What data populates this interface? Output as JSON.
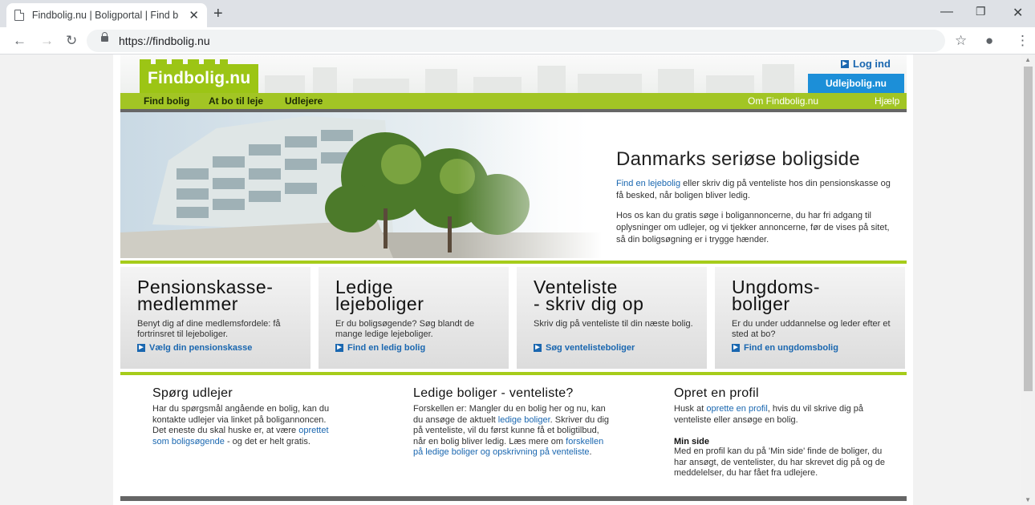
{
  "browser": {
    "tab_title": "Findbolig.nu | Boligportal | Find b",
    "url": "https://findbolig.nu"
  },
  "header": {
    "logo": "Findbolig.nu",
    "login": "Log ind",
    "udlejbolig": "Udlejbolig.nu"
  },
  "nav": {
    "left": [
      "Find bolig",
      "At bo til leje",
      "Udlejere"
    ],
    "right": [
      "Om Findbolig.nu",
      "Hjælp"
    ]
  },
  "hero": {
    "title": "Danmarks seriøse boligside",
    "p1_link": "Find en lejebolig",
    "p1_text": " eller skriv dig på venteliste hos din pensionskasse og få besked, når boligen bliver ledig.",
    "p2": "Hos os kan du gratis søge i boligannoncerne, du har fri adgang til oplysninger om udlejer, og vi tjekker annoncerne, før de vises på sitet, så din boligsøgning er i trygge hænder."
  },
  "tiles": [
    {
      "title_1": "Pensionskasse-",
      "title_2": "medlemmer",
      "text": "Benyt dig af dine medlemsfordele: få fortrinsret til lejeboliger.",
      "link": "Vælg din pensionskasse"
    },
    {
      "title_1": "Ledige",
      "title_2": "lejeboliger",
      "text": "Er du boligsøgende? Søg blandt de mange ledige lejeboliger.",
      "link": "Find en ledig bolig"
    },
    {
      "title_1": "Venteliste",
      "title_2": "- skriv dig op",
      "text": "Skriv dig på venteliste til din næste bolig.",
      "link": "Søg ventelisteboliger"
    },
    {
      "title_1": "Ungdoms-",
      "title_2": "boliger",
      "text": "Er du under uddannelse og leder efter et sted at bo?",
      "link": "Find en ungdomsbolig"
    }
  ],
  "columns": {
    "c1": {
      "title": "Spørg udlejer",
      "p1": "Har du spørgsmål angående en bolig, kan du kontakte udlejer via linket på boligannoncen.",
      "p2_a": "Det eneste du skal huske er, at være ",
      "p2_link": "oprettet som boligsøgende",
      "p2_b": " - og det er helt gratis."
    },
    "c2": {
      "title": "Ledige boliger - venteliste?",
      "p_a": "Forskellen er: Mangler du en bolig her og nu, kan du ansøge de aktuelt ",
      "p_link1": "ledige boliger",
      "p_b": ". Skriver du dig på venteliste, vil du først kunne få et boligtilbud, når en bolig bliver ledig. Læs mere om ",
      "p_link2": "forskellen på ledige boliger og opskrivning på venteliste",
      "p_c": "."
    },
    "c3": {
      "title": "Opret en profil",
      "p_a": "Husk at ",
      "p_link": "oprette en profil",
      "p_b": ", hvis du vil skrive dig på venteliste eller ansøge en bolig.",
      "sub": "Min side",
      "p2": "Med en profil kan du på 'Min side' finde de boliger, du har ansøgt, de ventelister, du har skrevet dig på og de meddelelser, du har fået fra udlejere."
    }
  },
  "colors": {
    "green": "#a6cc1a",
    "link": "#1a67b0",
    "blue_button": "#1c8fd8"
  }
}
